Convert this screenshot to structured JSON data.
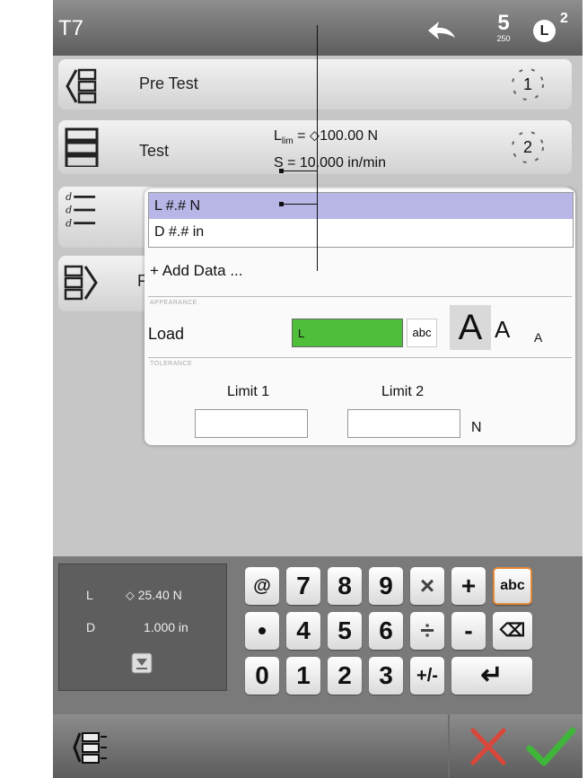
{
  "header": {
    "title": "T7",
    "steps_count": "5",
    "steps_sub": "250",
    "badge": "L",
    "badge_sup": "2"
  },
  "rows": [
    {
      "label": "Pre Test",
      "step": "1"
    },
    {
      "label": "Test",
      "step": "2",
      "param1_prefix": "L",
      "param1_sub": "lim",
      "param1_rest": " = ⬦100.00 N",
      "param2": "S = 10.000 in/min"
    },
    {
      "label": ""
    },
    {
      "label": "F"
    }
  ],
  "popup": {
    "data_items": [
      "L  #.# N",
      "D  #.# in"
    ],
    "add_data": "+ Add Data ...",
    "appearance_tag": "APPEARANCE",
    "load_label": "Load",
    "load_value": "L",
    "abc_label": "abc",
    "font_sizes": [
      "A",
      "A",
      "A"
    ],
    "tolerance_tag": "TOLERANCE",
    "limit1": "Limit 1",
    "limit2": "Limit 2",
    "unit": "N"
  },
  "readout": {
    "l_label": "L",
    "l_value": "⬦ 25.40 N",
    "d_label": "D",
    "d_value": "1.000 in"
  },
  "keypad": [
    [
      "@",
      "7",
      "8",
      "9",
      "×",
      "+",
      "abc"
    ],
    [
      "•",
      "4",
      "5",
      "6",
      "÷",
      "-",
      "⌫"
    ],
    [
      "0",
      "1",
      "2",
      "3",
      "+/-",
      "",
      "↵"
    ]
  ],
  "colors": {
    "selected_item": "#b8b6e6",
    "load_field": "#4fbe3a",
    "cancel": "#d9473a",
    "ok": "#3fb63a"
  }
}
